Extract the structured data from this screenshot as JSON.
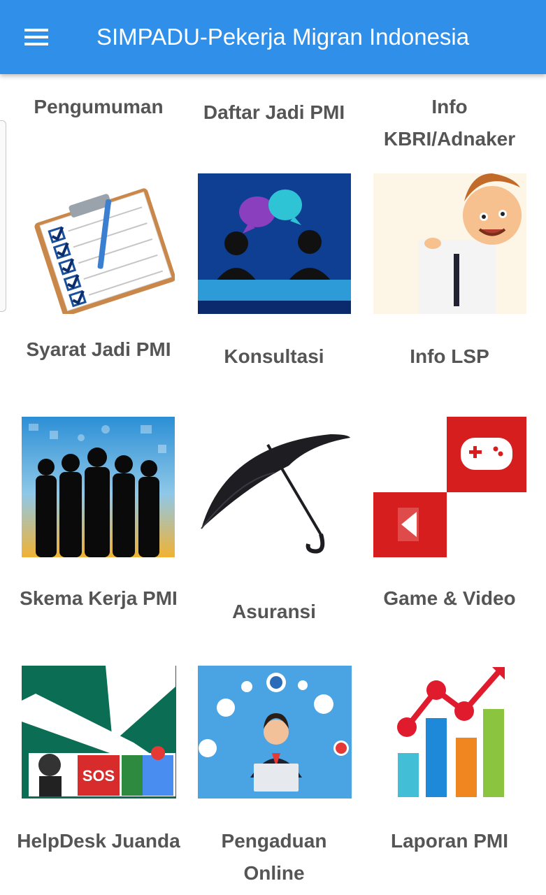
{
  "appbar": {
    "title": "SIMPADU-Pekerja Migran Indonesia",
    "menu_icon": "hamburger-menu-icon",
    "color": "#2f8fe9"
  },
  "menu": [
    {
      "label": "Pengumuman",
      "icon": "checklist-clipboard-icon"
    },
    {
      "label": "Daftar Jadi PMI",
      "icon": "consultation-people-icon"
    },
    {
      "label": "Info KBRI/Adnaker",
      "icon": "cartoon-man-sign-icon"
    },
    {
      "label": "Syarat Jadi PMI",
      "icon": "silhouette-group-icon"
    },
    {
      "label": "Konsultasi",
      "icon": "umbrella-icon"
    },
    {
      "label": "Info LSP",
      "icon": "game-video-icon"
    },
    {
      "label": "Skema Kerja PMI",
      "icon": "airplane-helpdesk-icon"
    },
    {
      "label": "Asuransi",
      "icon": "online-complaint-icon"
    },
    {
      "label": "Game & Video",
      "icon": "growth-chart-icon"
    },
    {
      "label": "HelpDesk Juanda"
    },
    {
      "label": "Pengaduan Online"
    },
    {
      "label": "Laporan PMI"
    }
  ],
  "image_texts": {
    "sos": "SOS"
  }
}
